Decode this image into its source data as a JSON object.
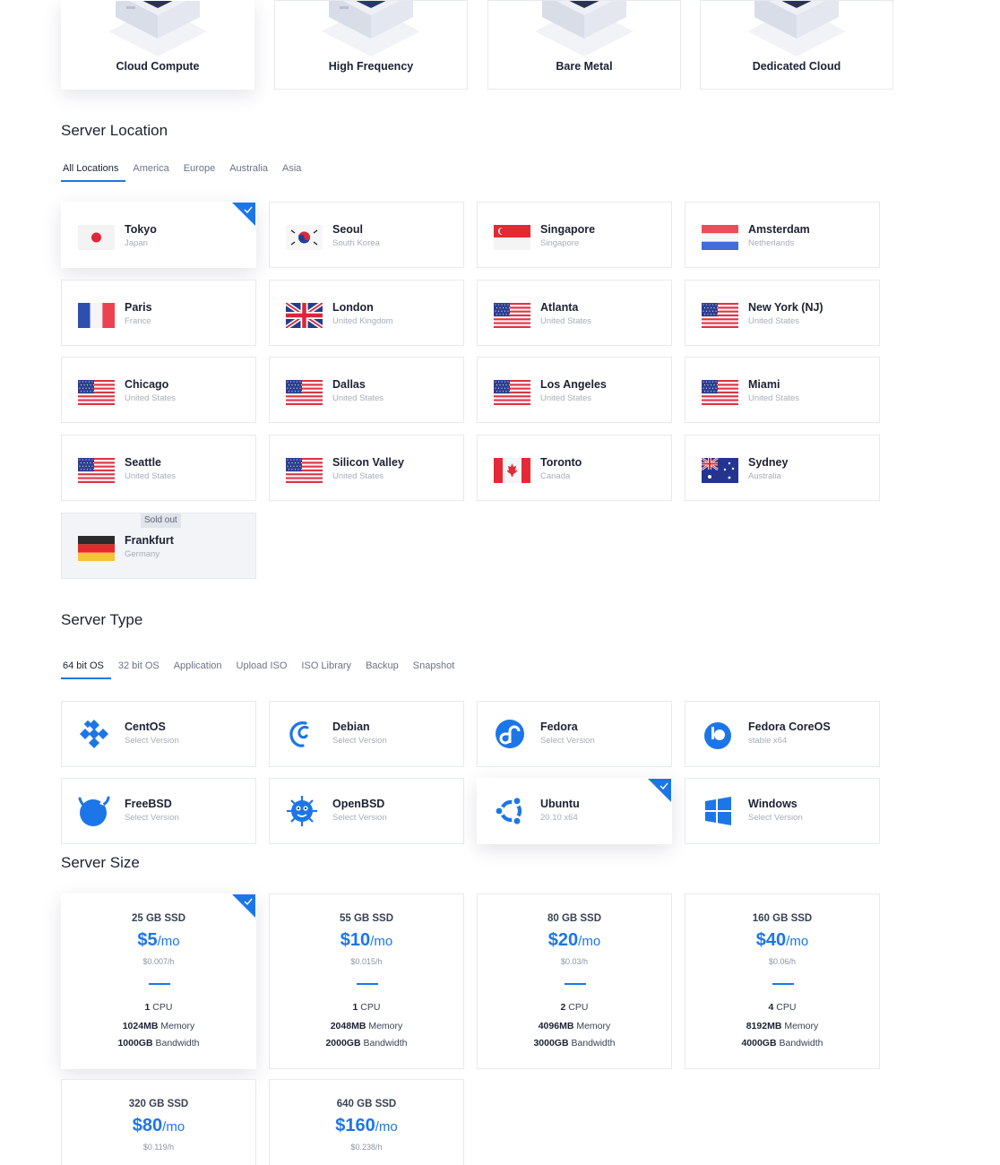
{
  "products": [
    {
      "label": "Cloud Compute",
      "selected": true
    },
    {
      "label": "High Frequency",
      "selected": false
    },
    {
      "label": "Bare Metal",
      "selected": false
    },
    {
      "label": "Dedicated Cloud",
      "selected": false
    }
  ],
  "location": {
    "title": "Server Location",
    "tabs": [
      "All Locations",
      "America",
      "Europe",
      "Australia",
      "Asia"
    ],
    "active_tab": "All Locations",
    "items": [
      {
        "city": "Tokyo",
        "country": "Japan",
        "flag": "flag-japan",
        "selected": true
      },
      {
        "city": "Seoul",
        "country": "South Korea",
        "flag": "flag-south-korea"
      },
      {
        "city": "Singapore",
        "country": "Singapore",
        "flag": "flag-singapore"
      },
      {
        "city": "Amsterdam",
        "country": "Netherlands",
        "flag": "flag-netherlands"
      },
      {
        "city": "Paris",
        "country": "France",
        "flag": "flag-france"
      },
      {
        "city": "London",
        "country": "United Kingdom",
        "flag": "flag-united-kingdom"
      },
      {
        "city": "Atlanta",
        "country": "United States",
        "flag": "flag-united-states"
      },
      {
        "city": "New York (NJ)",
        "country": "United States",
        "flag": "flag-united-states"
      },
      {
        "city": "Chicago",
        "country": "United States",
        "flag": "flag-united-states"
      },
      {
        "city": "Dallas",
        "country": "United States",
        "flag": "flag-united-states"
      },
      {
        "city": "Los Angeles",
        "country": "United States",
        "flag": "flag-united-states"
      },
      {
        "city": "Miami",
        "country": "United States",
        "flag": "flag-united-states"
      },
      {
        "city": "Seattle",
        "country": "United States",
        "flag": "flag-united-states"
      },
      {
        "city": "Silicon Valley",
        "country": "United States",
        "flag": "flag-united-states"
      },
      {
        "city": "Toronto",
        "country": "Canada",
        "flag": "flag-canada"
      },
      {
        "city": "Sydney",
        "country": "Australia",
        "flag": "flag-australia"
      },
      {
        "city": "Frankfurt",
        "country": "Germany",
        "flag": "flag-germany",
        "badge": "Sold out"
      }
    ]
  },
  "server_type": {
    "title": "Server Type",
    "tabs": [
      "64 bit OS",
      "32 bit OS",
      "Application",
      "Upload ISO",
      "ISO Library",
      "Backup",
      "Snapshot"
    ],
    "active_tab": "64 bit OS",
    "items": [
      {
        "name": "CentOS",
        "version": "Select Version",
        "icon": "centos-icon"
      },
      {
        "name": "Debian",
        "version": "Select Version",
        "icon": "debian-icon"
      },
      {
        "name": "Fedora",
        "version": "Select Version",
        "icon": "fedora-icon"
      },
      {
        "name": "Fedora CoreOS",
        "version": "stable  x64",
        "icon": "fedora-coreos-icon"
      },
      {
        "name": "FreeBSD",
        "version": "Select Version",
        "icon": "freebsd-icon"
      },
      {
        "name": "OpenBSD",
        "version": "Select Version",
        "icon": "openbsd-icon"
      },
      {
        "name": "Ubuntu",
        "version": "20.10  x64",
        "icon": "ubuntu-icon",
        "selected": true
      },
      {
        "name": "Windows",
        "version": "Select Version",
        "icon": "windows-icon"
      }
    ]
  },
  "server_size": {
    "title": "Server Size",
    "items": [
      {
        "disk": "25 GB SSD",
        "price": "$5",
        "per": "/mo",
        "hourly": "$0.007/h",
        "cpu": "1",
        "cpu_label": "CPU",
        "memory": "1024MB",
        "memory_label": "Memory",
        "bandwidth": "1000GB",
        "bandwidth_label": "Bandwidth",
        "selected": true
      },
      {
        "disk": "55 GB SSD",
        "price": "$10",
        "per": "/mo",
        "hourly": "$0.015/h",
        "cpu": "1",
        "cpu_label": "CPU",
        "memory": "2048MB",
        "memory_label": "Memory",
        "bandwidth": "2000GB",
        "bandwidth_label": "Bandwidth"
      },
      {
        "disk": "80 GB SSD",
        "price": "$20",
        "per": "/mo",
        "hourly": "$0.03/h",
        "cpu": "2",
        "cpu_label": "CPU",
        "memory": "4096MB",
        "memory_label": "Memory",
        "bandwidth": "3000GB",
        "bandwidth_label": "Bandwidth"
      },
      {
        "disk": "160 GB SSD",
        "price": "$40",
        "per": "/mo",
        "hourly": "$0.06/h",
        "cpu": "4",
        "cpu_label": "CPU",
        "memory": "8192MB",
        "memory_label": "Memory",
        "bandwidth": "4000GB",
        "bandwidth_label": "Bandwidth"
      },
      {
        "disk": "320 GB SSD",
        "price": "$80",
        "per": "/mo",
        "hourly": "$0.119/h"
      },
      {
        "disk": "640 GB SSD",
        "price": "$160",
        "per": "/mo",
        "hourly": "$0.238/h"
      }
    ]
  },
  "colors": {
    "accent": "#1c76e8",
    "text": "#1c2233",
    "muted": "#a7adba",
    "border": "#e6e9ef"
  }
}
